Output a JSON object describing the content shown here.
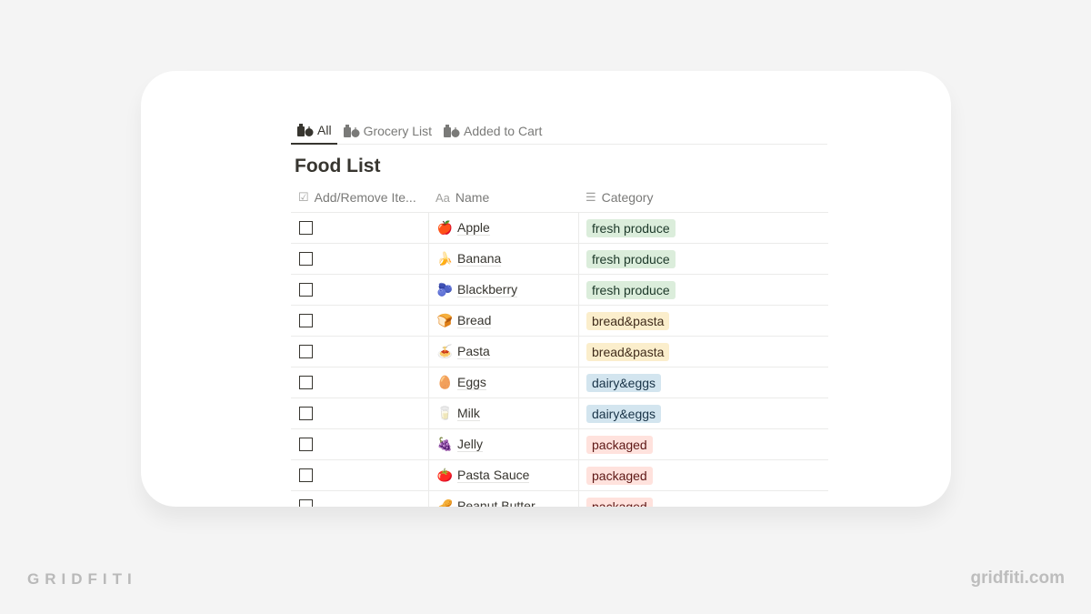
{
  "tabs": [
    {
      "label": "All",
      "icon": "grocery-bag-icon",
      "active": true
    },
    {
      "label": "Grocery List",
      "icon": "grocery-bag-icon",
      "active": false
    },
    {
      "label": "Added to Cart",
      "icon": "grocery-bag-icon",
      "active": false
    }
  ],
  "page_title": "Food List",
  "table": {
    "columns": [
      {
        "label": "Add/Remove Ite...",
        "icon": "checkbox-icon",
        "icon_glyph": "☑"
      },
      {
        "label": "Name",
        "icon": "text-property-icon",
        "icon_glyph": "Aa"
      },
      {
        "label": "Category",
        "icon": "list-icon",
        "icon_glyph": "☰"
      }
    ],
    "rows": [
      {
        "checked": false,
        "emoji": "🍎",
        "name": "Apple",
        "category": "fresh produce",
        "tag_bg": "#dbeddb",
        "tag_fg": "#1c3829"
      },
      {
        "checked": false,
        "emoji": "🍌",
        "name": "Banana",
        "category": "fresh produce",
        "tag_bg": "#dbeddb",
        "tag_fg": "#1c3829"
      },
      {
        "checked": false,
        "emoji": "🫐",
        "name": "Blackberry",
        "category": "fresh produce",
        "tag_bg": "#dbeddb",
        "tag_fg": "#1c3829"
      },
      {
        "checked": false,
        "emoji": "🍞",
        "name": "Bread",
        "category": "bread&pasta",
        "tag_bg": "#fbeecc",
        "tag_fg": "#402c1b"
      },
      {
        "checked": false,
        "emoji": "🍝",
        "name": "Pasta",
        "category": "bread&pasta",
        "tag_bg": "#fbeecc",
        "tag_fg": "#402c1b"
      },
      {
        "checked": false,
        "emoji": "🥚",
        "name": "Eggs",
        "category": "dairy&eggs",
        "tag_bg": "#d3e5ef",
        "tag_fg": "#183347"
      },
      {
        "checked": false,
        "emoji": "🥛",
        "name": "Milk",
        "category": "dairy&eggs",
        "tag_bg": "#d3e5ef",
        "tag_fg": "#183347"
      },
      {
        "checked": false,
        "emoji": "🍇",
        "name": "Jelly",
        "category": "packaged",
        "tag_bg": "#ffe2dd",
        "tag_fg": "#5d1715"
      },
      {
        "checked": false,
        "emoji": "🍅",
        "name": "Pasta Sauce",
        "category": "packaged",
        "tag_bg": "#ffe2dd",
        "tag_fg": "#5d1715"
      },
      {
        "checked": false,
        "emoji": "🥜",
        "name": "Peanut Butter",
        "category": "packaged",
        "tag_bg": "#ffe2dd",
        "tag_fg": "#5d1715"
      }
    ]
  },
  "footer": {
    "brand": "GRIDFITI",
    "url": "gridfiti.com"
  }
}
